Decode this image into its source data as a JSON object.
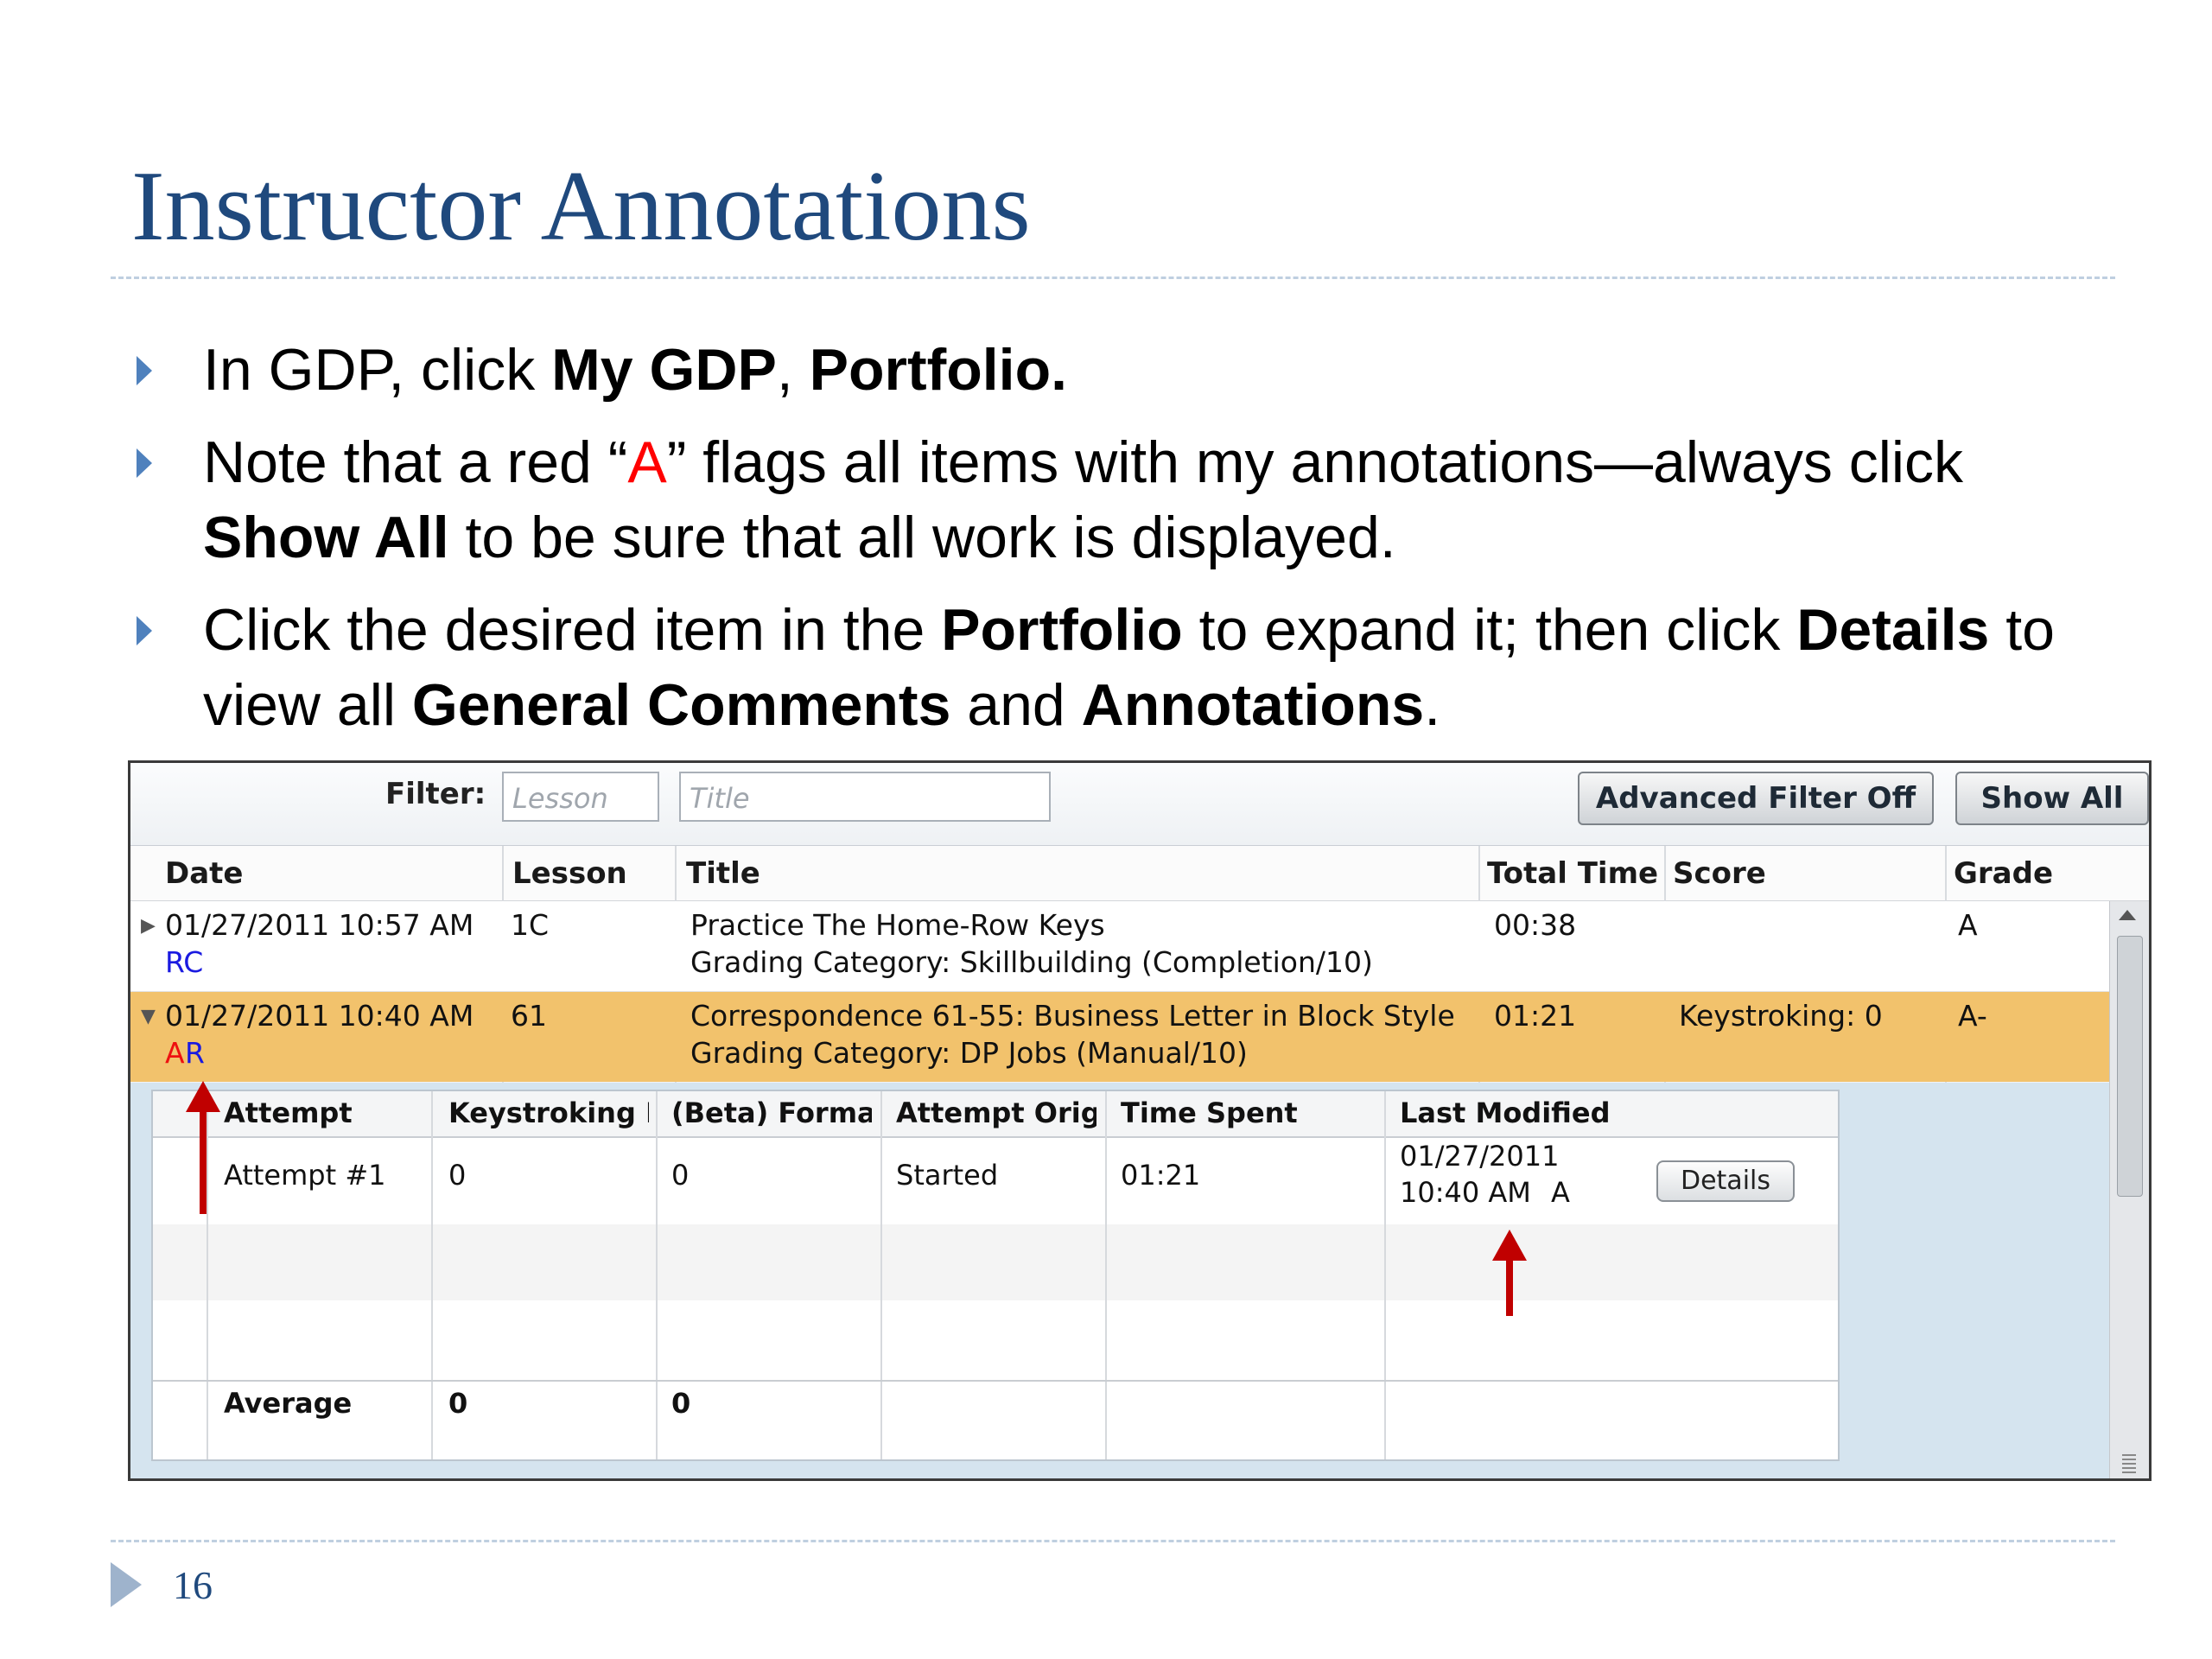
{
  "slide": {
    "title": "Instructor Annotations",
    "page_number": "16",
    "bullets": [
      {
        "parts": [
          "In GDP, click ",
          "My GDP",
          ", ",
          "Portfolio."
        ]
      },
      {
        "parts": [
          "Note that a red “",
          "A",
          "” flags all items with my annotations—always click ",
          "Show All",
          " to be sure that all work is displayed."
        ]
      },
      {
        "parts": [
          "Click the desired item in the ",
          "Portfolio",
          " to expand it; then click ",
          "Details",
          " to view all ",
          "General Comments",
          " and ",
          "Annotations",
          "."
        ]
      }
    ]
  },
  "portfolio": {
    "filter_label": "Filter:",
    "lesson_placeholder": "Lesson",
    "title_placeholder": "Title",
    "advanced_filter_button": "Advanced Filter Off",
    "show_all_button": "Show All",
    "columns": [
      "Date",
      "Lesson",
      "Title",
      "Total Time",
      "Score",
      "Grade"
    ],
    "rows": [
      {
        "expander": "▶",
        "date": "01/27/2011 10:57 AM",
        "flags": [
          {
            "text": "RC",
            "color": "blue"
          }
        ],
        "lesson": "1C",
        "title": "Practice The Home-Row Keys",
        "category": "Grading Category: Skillbuilding (Completion/10)",
        "total_time": "00:38",
        "score": "",
        "grade": "A"
      },
      {
        "expander": "▼",
        "date": "01/27/2011 10:40 AM",
        "flags": [
          {
            "text": "A",
            "color": "red"
          },
          {
            "text": "R",
            "color": "blue"
          }
        ],
        "lesson": "61",
        "title": "Correspondence 61-55: Business Letter in Block Style",
        "category": "Grading Category: DP Jobs (Manual/10)",
        "total_time": "01:21",
        "score": "Keystroking: 0",
        "grade": "A-"
      }
    ],
    "detail": {
      "columns": [
        "Attempt",
        "Keystroking E",
        "(Beta) Forma",
        "Attempt Origi",
        "Time Spent",
        "Last Modified"
      ],
      "attempt": {
        "name": "Attempt #1",
        "keystroking": "0",
        "beta_format": "0",
        "origin": "Started",
        "time_spent": "01:21",
        "last_modified_date": "01/27/2011",
        "last_modified_time": "10:40 AM",
        "annotation_flag": "A",
        "details_button": "Details"
      },
      "average": {
        "label": "Average",
        "keystroking": "0",
        "beta_format": "0"
      }
    }
  },
  "colors": {
    "title": "#1f497d",
    "bullet": "#4f81bd",
    "selected_row": "#f2c26c",
    "annotation_red": "#ee1010",
    "annotation_blue": "#1a1ae0",
    "arrow": "#c00000"
  }
}
